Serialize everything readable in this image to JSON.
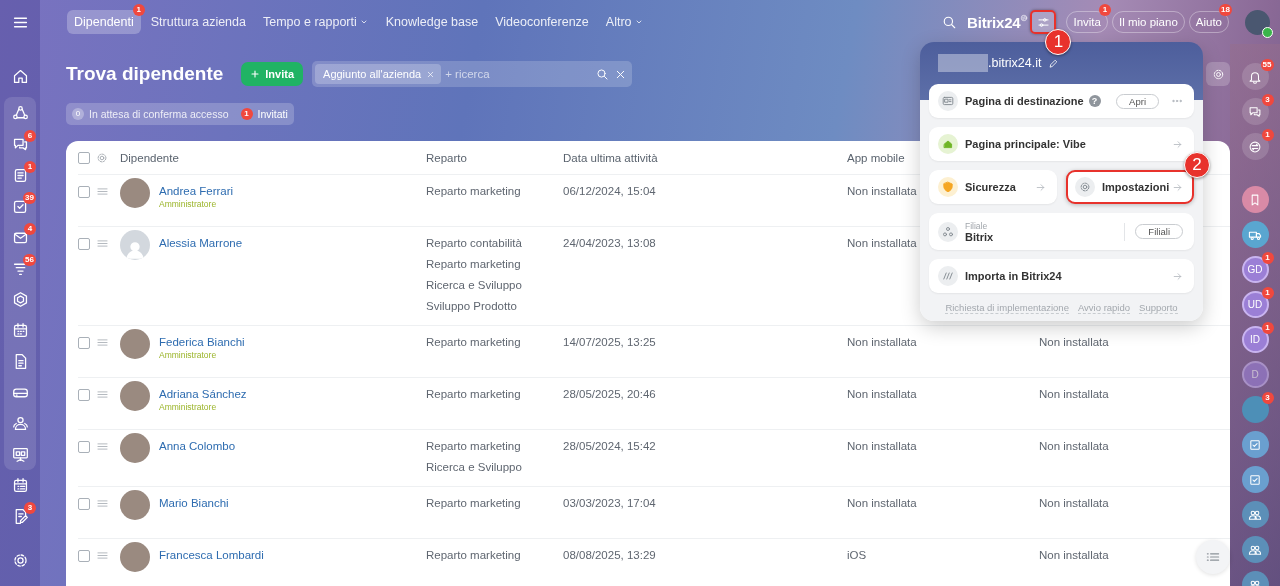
{
  "left_sidebar": {
    "items": [
      {
        "kind": "menu"
      },
      {
        "kind": "home"
      }
    ],
    "panel": {
      "items": [
        {
          "kind": "flow"
        },
        {
          "kind": "chat",
          "badge": "6"
        },
        {
          "kind": "feed",
          "badge": "1"
        },
        {
          "kind": "tasks",
          "badge": "39"
        },
        {
          "kind": "mail",
          "badge": "4"
        },
        {
          "kind": "funnel",
          "badge": "56"
        },
        {
          "kind": "hexagon"
        },
        {
          "kind": "calendar"
        },
        {
          "kind": "document"
        },
        {
          "kind": "drive"
        },
        {
          "kind": "people"
        },
        {
          "kind": "board"
        }
      ]
    },
    "more_items": [
      {
        "kind": "schedule"
      },
      {
        "kind": "edit",
        "badge": "3"
      }
    ],
    "footer_items": [
      {
        "kind": "settings"
      }
    ]
  },
  "top_nav": {
    "tabs": [
      {
        "label": "Dipendenti",
        "selected": true,
        "badge": "1",
        "dropdown": false
      },
      {
        "label": "Struttura azienda",
        "selected": false,
        "dropdown": false
      },
      {
        "label": "Tempo e rapporti",
        "selected": false,
        "dropdown": true
      },
      {
        "label": "Knowledge base",
        "selected": false,
        "dropdown": false
      },
      {
        "label": "Videoconferenze",
        "selected": false,
        "dropdown": false
      },
      {
        "label": "Altro",
        "selected": false,
        "dropdown": true
      }
    ],
    "brand": "Bitrix24",
    "settings_button": {
      "highlighted": true,
      "callout": "1"
    },
    "buttons": [
      {
        "label": "Invita",
        "badge": "1"
      },
      {
        "label": "Il mio piano"
      },
      {
        "label": "Aiuto",
        "badge": "18"
      }
    ]
  },
  "page": {
    "title": "Trova dipendente",
    "invite_button": "Invita",
    "search": {
      "chip": "Aggiunto all'azienda",
      "placeholder": "+ ricerca"
    },
    "counters": [
      {
        "count": "0",
        "label": "In attesa di conferma accesso",
        "alert": false
      },
      {
        "count": "1",
        "label": "Invitati",
        "alert": true
      }
    ]
  },
  "table": {
    "all_checked": false,
    "columns": [
      "Dipendente",
      "Reparto",
      "Data ultima attività",
      "App mobile"
    ],
    "rows": [
      {
        "checked": false,
        "has_photo": true,
        "name": "Andrea Ferrari",
        "role": "Amministratore",
        "departments": [
          "Reparto marketing"
        ],
        "last_activity": "06/12/2024, 15:04",
        "app_mobile": "Non installata"
      },
      {
        "checked": false,
        "has_photo": false,
        "name": "Alessia Marrone",
        "departments": [
          "Reparto contabilità",
          "Reparto marketing",
          "Ricerca e Sviluppo",
          "Sviluppo Prodotto"
        ],
        "last_activity": "24/04/2023, 13:08",
        "app_mobile": "Non installata"
      },
      {
        "checked": false,
        "has_photo": true,
        "name": "Federica Bianchi",
        "role": "Amministratore",
        "departments": [
          "Reparto marketing"
        ],
        "last_activity": "14/07/2025, 13:25",
        "app_mobile": "Non installata",
        "column_5": "Non installata"
      },
      {
        "checked": false,
        "has_photo": true,
        "name": "Adriana Sánchez",
        "role": "Amministratore",
        "departments": [
          "Reparto marketing"
        ],
        "last_activity": "28/05/2025, 20:46",
        "app_mobile": "Non installata",
        "column_5": "Non installata"
      },
      {
        "checked": false,
        "has_photo": true,
        "name": "Anna Colombo",
        "departments": [
          "Reparto marketing",
          "Ricerca e Sviluppo"
        ],
        "last_activity": "28/05/2024, 15:42",
        "app_mobile": "Non installata",
        "column_5": "Non installata"
      },
      {
        "checked": false,
        "has_photo": true,
        "name": "Mario Bianchi",
        "departments": [
          "Reparto marketing"
        ],
        "last_activity": "03/03/2023, 17:04",
        "app_mobile": "Non installata",
        "column_5": "Non installata"
      },
      {
        "checked": false,
        "has_photo": true,
        "name": "Francesca Lombardi",
        "departments": [
          "Reparto marketing"
        ],
        "last_activity": "08/08/2025, 13:29",
        "app_mobile": "iOS",
        "column_5": "Non installata"
      }
    ]
  },
  "popup": {
    "portal": ".bitrix24.it",
    "cards": [
      {
        "kind": "landing",
        "label": "Pagina di destinazione",
        "help": "?",
        "button": "Apri"
      },
      {
        "kind": "home",
        "label": "Pagina principale: Vibe"
      },
      {
        "kind": "pair",
        "items": [
          {
            "kind": "security",
            "label": "Sicurezza",
            "highlighted": false
          },
          {
            "kind": "settings",
            "label": "Impostazioni",
            "highlighted": true,
            "callout": "2"
          }
        ]
      },
      {
        "kind": "branch",
        "caption": "Filiale",
        "value": "Bitrix",
        "button": "Filiali"
      },
      {
        "kind": "import",
        "label": "Importa in Bitrix24"
      }
    ],
    "footer_links": [
      "Richiesta di implementazione",
      "Avvio rapido",
      "Supporto"
    ]
  },
  "right_sidebar": {
    "items": [
      {
        "kind": "bell",
        "badge": "55",
        "faded": false
      },
      {
        "kind": "chat",
        "badge": "3",
        "faded": false
      },
      {
        "kind": "swap",
        "badge": "1",
        "faded": false
      },
      {
        "kind": "bookmark",
        "faded": false
      },
      {
        "kind": "truck",
        "faded": false
      },
      {
        "kind": "initials",
        "initials": "GD",
        "badge": "1",
        "faded": false
      },
      {
        "kind": "initials",
        "initials": "UD",
        "badge": "1",
        "faded": false
      },
      {
        "kind": "initials",
        "initials": "ID",
        "badge": "1",
        "faded": false
      },
      {
        "kind": "initials",
        "initials": "D",
        "faded": true
      },
      {
        "kind": "avatar",
        "badge": "3",
        "faded": false
      },
      {
        "kind": "task",
        "faded": false
      },
      {
        "kind": "task",
        "faded": false
      },
      {
        "kind": "group",
        "faded": false
      },
      {
        "kind": "group",
        "faded": false
      },
      {
        "kind": "group",
        "faded": false
      }
    ]
  }
}
